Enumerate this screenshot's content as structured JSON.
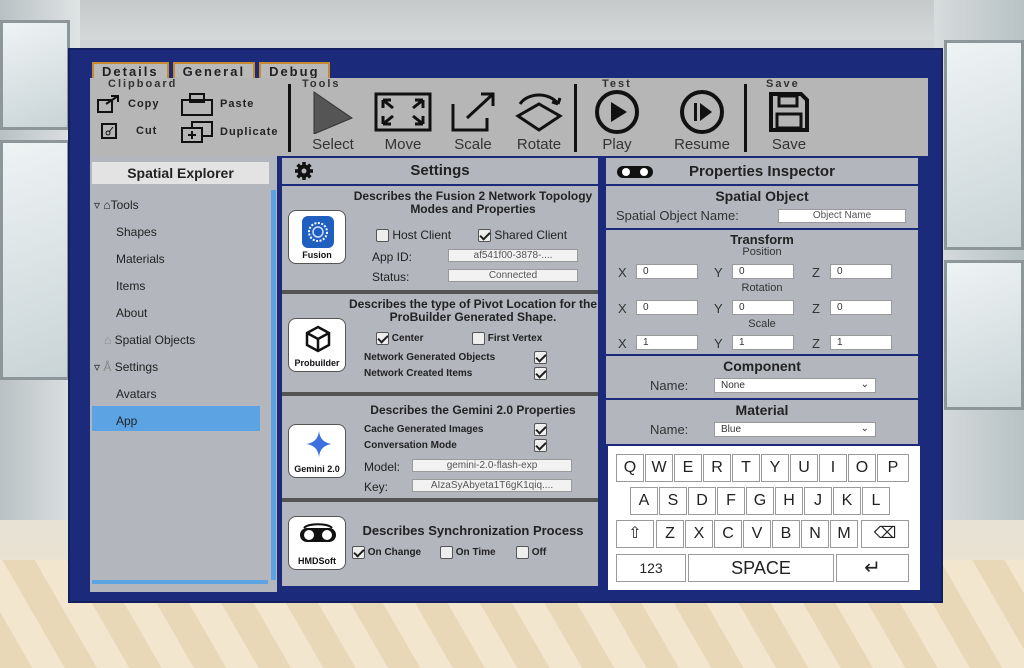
{
  "tabs": [
    "Details",
    "General",
    "Debug"
  ],
  "toolbar": {
    "clipboard_title": "Clipboard",
    "tools_title": "Tools",
    "test_title": "Test",
    "save_title": "Save",
    "copy": "Copy",
    "paste": "Paste",
    "cut": "Cut",
    "duplicate": "Duplicate",
    "select": "Select",
    "move": "Move",
    "scale": "Scale",
    "rotate": "Rotate",
    "play": "Play",
    "resume": "Resume",
    "save": "Save"
  },
  "explorer": {
    "title": "Spatial Explorer",
    "items": [
      "Tools",
      "Shapes",
      "Materials",
      "Items",
      "About",
      "Spatial Objects",
      "Settings",
      "Avatars",
      "App"
    ],
    "selected": "App"
  },
  "settings": {
    "title": "Settings",
    "fusion": {
      "desc": "Describes the Fusion 2 Network Topology Modes and Properties",
      "logo": "Fusion",
      "host_client": "Host Client",
      "host_client_checked": false,
      "shared_client": "Shared Client",
      "shared_client_checked": true,
      "app_id_label": "App ID:",
      "app_id": "af541f00-3878-....",
      "status_label": "Status:",
      "status": "Connected"
    },
    "probuilder": {
      "desc": "Describes the type of Pivot Location for the ProBuilder Generated Shape.",
      "logo": "Probuilder",
      "center": "Center",
      "center_checked": true,
      "first_vertex": "First Vertex",
      "first_vertex_checked": false,
      "net_gen": "Network Generated Objects",
      "net_created": "Network Created Items"
    },
    "gemini": {
      "desc": "Describes the Gemini 2.0 Properties",
      "logo": "Gemini 2.0",
      "cache": "Cache Generated Images",
      "conversation": "Conversation Mode",
      "model_label": "Model:",
      "model": "gemini-2.0-flash-exp",
      "key_label": "Key:",
      "key": "AIzaSyAbyeta1T6gK1qiq...."
    },
    "sync": {
      "desc": "Describes Synchronization Process",
      "logo": "HMDSoft",
      "on_change": "On Change",
      "on_time": "On Time",
      "off": "Off"
    }
  },
  "props": {
    "title": "Properties Inspector",
    "spatial_object_title": "Spatial Object",
    "name_label": "Spatial Object Name:",
    "name_placeholder": "Object Name",
    "transform_title": "Transform",
    "position": "Position",
    "rotation": "Rotation",
    "scale": "Scale",
    "x": "X",
    "y": "Y",
    "z": "Z",
    "pos": [
      "0",
      "0",
      "0"
    ],
    "rot": [
      "0",
      "0",
      "0"
    ],
    "scl": [
      "1",
      "1",
      "1"
    ],
    "component_title": "Component",
    "component_label": "Name:",
    "component_value": "None",
    "material_title": "Material",
    "material_label": "Name:",
    "material_value": "Blue"
  },
  "keyboard": {
    "row1": [
      "Q",
      "W",
      "E",
      "R",
      "T",
      "Y",
      "U",
      "I",
      "O",
      "P"
    ],
    "row2": [
      "A",
      "S",
      "D",
      "F",
      "G",
      "H",
      "J",
      "K",
      "L"
    ],
    "row3": [
      "Z",
      "X",
      "C",
      "V",
      "B",
      "N",
      "M"
    ],
    "num": "123",
    "space": "SPACE"
  }
}
